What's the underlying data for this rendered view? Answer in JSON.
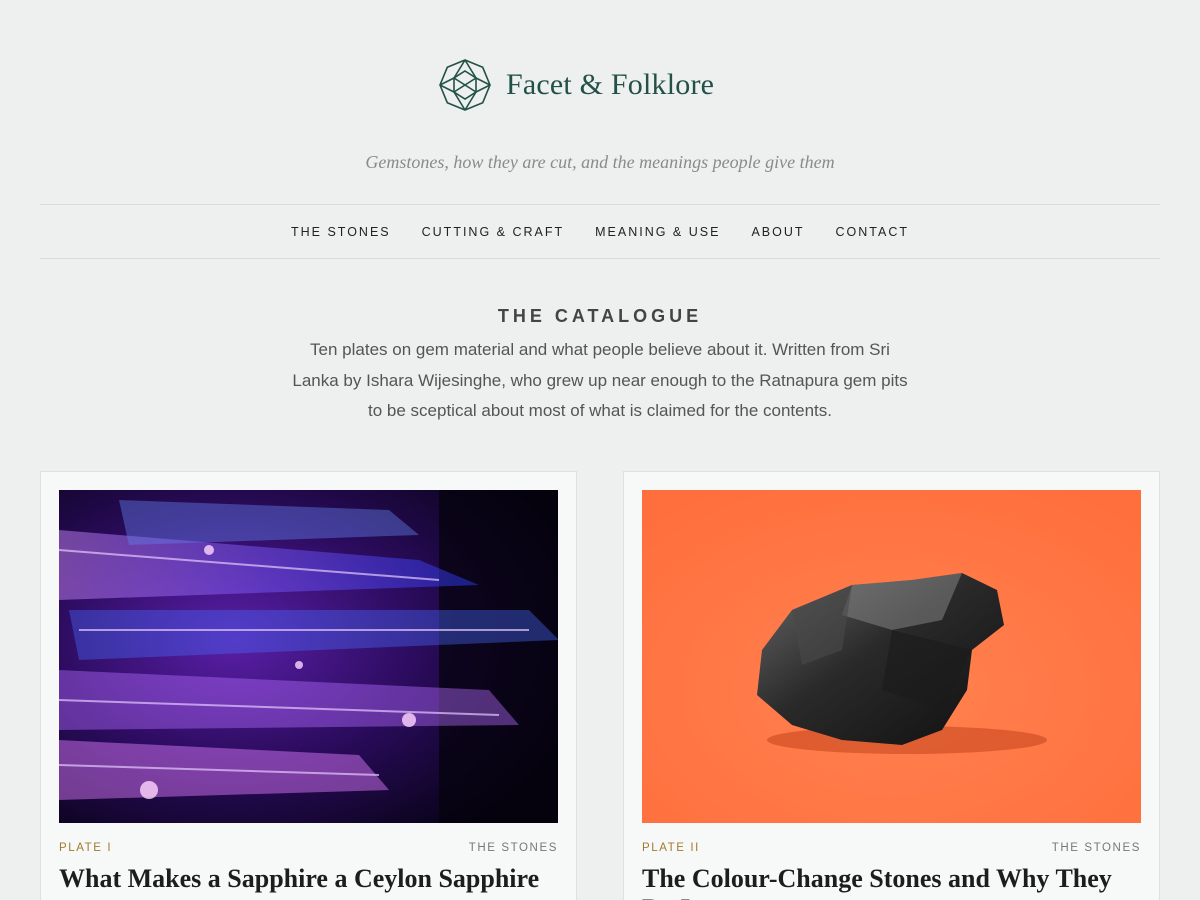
{
  "site": {
    "name": "Facet & Folklore",
    "tagline": "Gemstones, how they are cut, and the meanings people give them"
  },
  "nav": {
    "items": [
      {
        "label": "THE STONES"
      },
      {
        "label": "CUTTING & CRAFT"
      },
      {
        "label": "MEANING & USE"
      },
      {
        "label": "ABOUT"
      },
      {
        "label": "CONTACT"
      }
    ]
  },
  "intro": {
    "title": "THE CATALOGUE",
    "text": "Ten plates on gem material and what people believe about it. Written from Sri Lanka by Ishara Wijesinghe, who grew up near enough to the Ratnapura gem pits to be sceptical about most of what is claimed for the contents."
  },
  "cards": [
    {
      "plate": "PLATE I",
      "section": "THE STONES",
      "title": "What Makes a Sapphire a Ceylon Sapphire"
    },
    {
      "plate": "PLATE II",
      "section": "THE STONES",
      "title": "The Colour-Change Stones and Why They Do It"
    }
  ],
  "colors": {
    "background": "#edf0ef",
    "brand": "#235147",
    "plate_label": "#a07a2e"
  }
}
